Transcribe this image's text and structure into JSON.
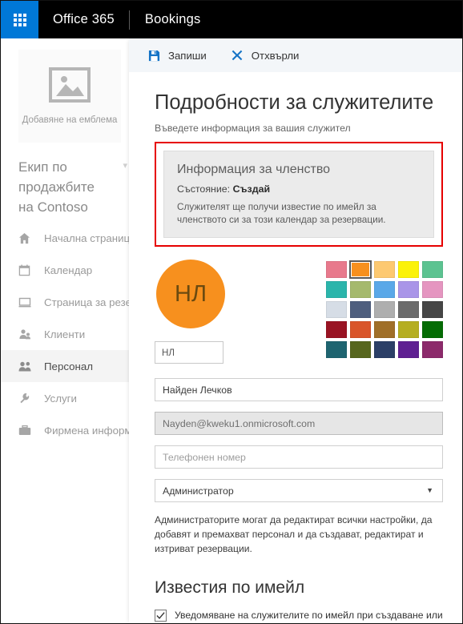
{
  "suite": {
    "waffle_label": "app-launcher",
    "brand": "Office 365",
    "app": "Bookings"
  },
  "sidebar": {
    "logo": {
      "caption": "Добавяне на емблема",
      "icon": "image-placeholder-icon"
    },
    "team_name": "Екип по продажбите на Contoso",
    "items": [
      {
        "label": "Начална страница",
        "icon": "home-icon",
        "selected": false
      },
      {
        "label": "Календар",
        "icon": "calendar-icon",
        "selected": false
      },
      {
        "label": "Страница за резерв",
        "icon": "monitor-icon",
        "selected": false
      },
      {
        "label": "Клиенти",
        "icon": "customers-icon",
        "selected": false
      },
      {
        "label": "Персонал",
        "icon": "staff-icon",
        "selected": true
      },
      {
        "label": "Услуги",
        "icon": "wrench-icon",
        "selected": false
      },
      {
        "label": "Фирмена информац",
        "icon": "briefcase-icon",
        "selected": false
      }
    ]
  },
  "toolbar": {
    "save_label": "Запиши",
    "discard_label": "Отхвърли",
    "save_icon": "save-floppy-icon",
    "discard_icon": "close-x-icon",
    "icon_color": "#1473c6"
  },
  "page": {
    "title": "Подробности за служителите",
    "subtitle": "Въведете информация за вашия служител"
  },
  "membership_box": {
    "heading": "Информация за членство",
    "status_label": "Състояние:",
    "status_value": "Създай",
    "note": "Служителят ще получи известие по имейл за членството си за този календар за резервации.",
    "highlight_color": "#e60000"
  },
  "avatar": {
    "initials": "НЛ",
    "color": "#f7901e",
    "initials_input_value": "НЛ"
  },
  "palette": {
    "selected_index": 1,
    "colors": [
      "#e8798c",
      "#f7901e",
      "#fdc971",
      "#fbf20a",
      "#5cc391",
      "#2bb5ab",
      "#a5b96d",
      "#5aa8e8",
      "#a995e8",
      "#e595c0",
      "#d6dde6",
      "#4e5e7e",
      "#aeaeae",
      "#6b6b6b",
      "#464646",
      "#991323",
      "#d9552a",
      "#a06f28",
      "#b5ae21",
      "#046c04",
      "#1e6470",
      "#57661e",
      "#2b3f67",
      "#5f2092",
      "#8c2a6b"
    ]
  },
  "form": {
    "name_value": "Найден Лечков",
    "email_value": "Nayden@kweku1.onmicrosoft.com",
    "phone_placeholder": "Телефонен номер",
    "role_value": "Администратор",
    "role_description": "Администраторите могат да редактират всички настройки, да добавят и премахват персонал и да създават, редактират и изтриват резервации."
  },
  "notifications": {
    "section_title": "Известия по имейл",
    "checkbox_label": "Уведомяване на служителите по имейл при създаване или",
    "checkbox_checked": true
  }
}
